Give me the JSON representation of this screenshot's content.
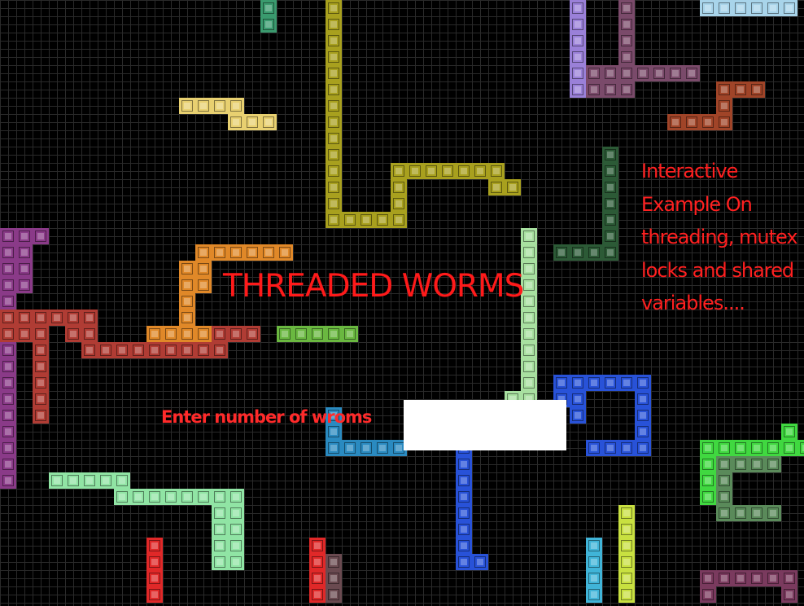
{
  "title": "THREADED WORMS",
  "description_lines": [
    "Interactive",
    "Example On",
    "threading, mutex",
    "locks and shared",
    "variables...."
  ],
  "prompt_label": "Enter number of wroms",
  "worm_count_input": {
    "value": "",
    "placeholder": ""
  },
  "colors": {
    "background": "#000000",
    "grid_line": "#2a2a2a",
    "text": "#ff1a1a",
    "input_background": "#ffffff"
  },
  "worms": [
    {
      "name": "teal-green",
      "color": "#3a9a6e"
    },
    {
      "name": "olive",
      "color": "#a8a01e"
    },
    {
      "name": "lavender",
      "color": "#9a80d8"
    },
    {
      "name": "plum",
      "color": "#7a4a6a"
    },
    {
      "name": "light-blue",
      "color": "#a8d4ea"
    },
    {
      "name": "khaki",
      "color": "#e8d070"
    },
    {
      "name": "rust",
      "color": "#a04428"
    },
    {
      "name": "dark-green",
      "color": "#2c5a36"
    },
    {
      "name": "pale-green",
      "color": "#a8e0a0"
    },
    {
      "name": "orange",
      "color": "#e08828"
    },
    {
      "name": "purple",
      "color": "#8a3a88"
    },
    {
      "name": "brick-red",
      "color": "#b03c34"
    },
    {
      "name": "green",
      "color": "#6ab840"
    },
    {
      "name": "cerulean",
      "color": "#2a8ac0"
    },
    {
      "name": "blue",
      "color": "#2852d8"
    },
    {
      "name": "mint",
      "color": "#90e4a4"
    },
    {
      "name": "bright-green",
      "color": "#40d840"
    },
    {
      "name": "sage",
      "color": "#5a8a5a"
    },
    {
      "name": "lime",
      "color": "#c8e040"
    },
    {
      "name": "sky-blue",
      "color": "#40b4d8"
    },
    {
      "name": "red",
      "color": "#e02828"
    },
    {
      "name": "mauve",
      "color": "#7a3a5e"
    },
    {
      "name": "gray-brown",
      "color": "#6a4a50"
    }
  ]
}
